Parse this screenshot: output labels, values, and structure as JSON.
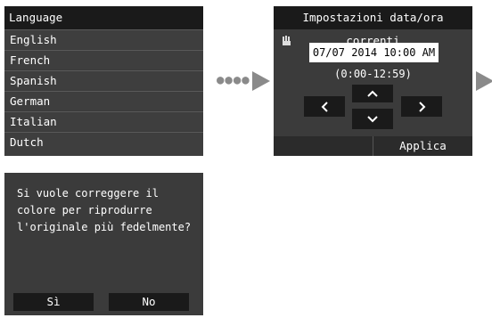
{
  "language_screen": {
    "title": "Language",
    "items": [
      "English",
      "French",
      "Spanish",
      "German",
      "Italian",
      "Dutch"
    ]
  },
  "date_screen": {
    "title": "Impostazioni data/ora correnti",
    "date_value": "07/07 2014 10:00 AM",
    "range": "(0:00-12:59)",
    "apply_label": "Applica",
    "icons": [
      "hand-icon",
      "up-arrow-icon",
      "left-arrow-icon",
      "right-arrow-icon",
      "down-arrow-icon"
    ]
  },
  "question_screen": {
    "text": "Si vuole correggere il\ncolore per riprodurre\nl'originale più fedelmente?",
    "yes_label": "Sì",
    "no_label": "No"
  },
  "colors": {
    "screen_bg": "#3b3b3b",
    "bar_bg": "#1a1a1a",
    "arrow": "#8a8a8a"
  }
}
